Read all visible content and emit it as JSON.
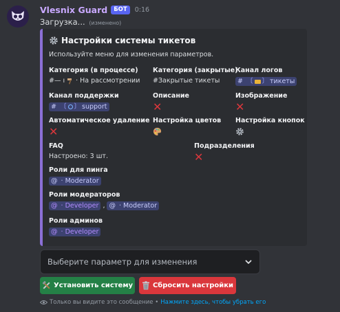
{
  "message": {
    "username": "Vlesnix Guard",
    "bot_badge": "БОТ",
    "timestamp": "0:16",
    "content": "Загрузка...",
    "edited": "(изменено)"
  },
  "embed": {
    "title": "Настройки системы тикетов",
    "description": "Используйте меню для изменения параметров.",
    "accent_color": "#8b6fd6",
    "fields": {
      "category_progress": {
        "name": "Категория (в процессе)",
        "value_prefix": "#—",
        "value_sep": "ı",
        "value_text": "· На рассмотрении"
      },
      "category_closed": {
        "name": "Категория (закрытые)",
        "value": "#Закрытые тикеты"
      },
      "log_channel": {
        "name": "Канал логов",
        "value": "тикеты"
      },
      "support_channel": {
        "name": "Канал поддержки",
        "value": "support"
      },
      "description": {
        "name": "Описание"
      },
      "image": {
        "name": "Изображение"
      },
      "auto_delete": {
        "name": "Автоматическое удаление"
      },
      "color_settings": {
        "name": "Настройка цветов"
      },
      "button_settings": {
        "name": "Настройка кнопок"
      },
      "faq": {
        "name": "FAQ",
        "value": "Настроено: 3 шт."
      },
      "subdivisions": {
        "name": "Подразделения"
      },
      "ping_roles": {
        "name": "Роли для пинга",
        "roles": [
          "· Moderator"
        ]
      },
      "moderator_roles": {
        "name": "Роли модераторов",
        "roles": [
          "· Developer",
          "· Moderator"
        ]
      },
      "admin_roles": {
        "name": "Роли админов",
        "roles": [
          "· Developer"
        ]
      }
    }
  },
  "select": {
    "placeholder": "Выберите параметр для изменения"
  },
  "buttons": {
    "install": "Установить систему",
    "reset": "Сбросить настройки"
  },
  "footer": {
    "text": "Только вы видите это сообщение •",
    "link": "Нажмите здесь, чтобы убрать его"
  },
  "colors": {
    "green": "#248046",
    "red": "#da373c",
    "blurple": "#5865f2"
  }
}
